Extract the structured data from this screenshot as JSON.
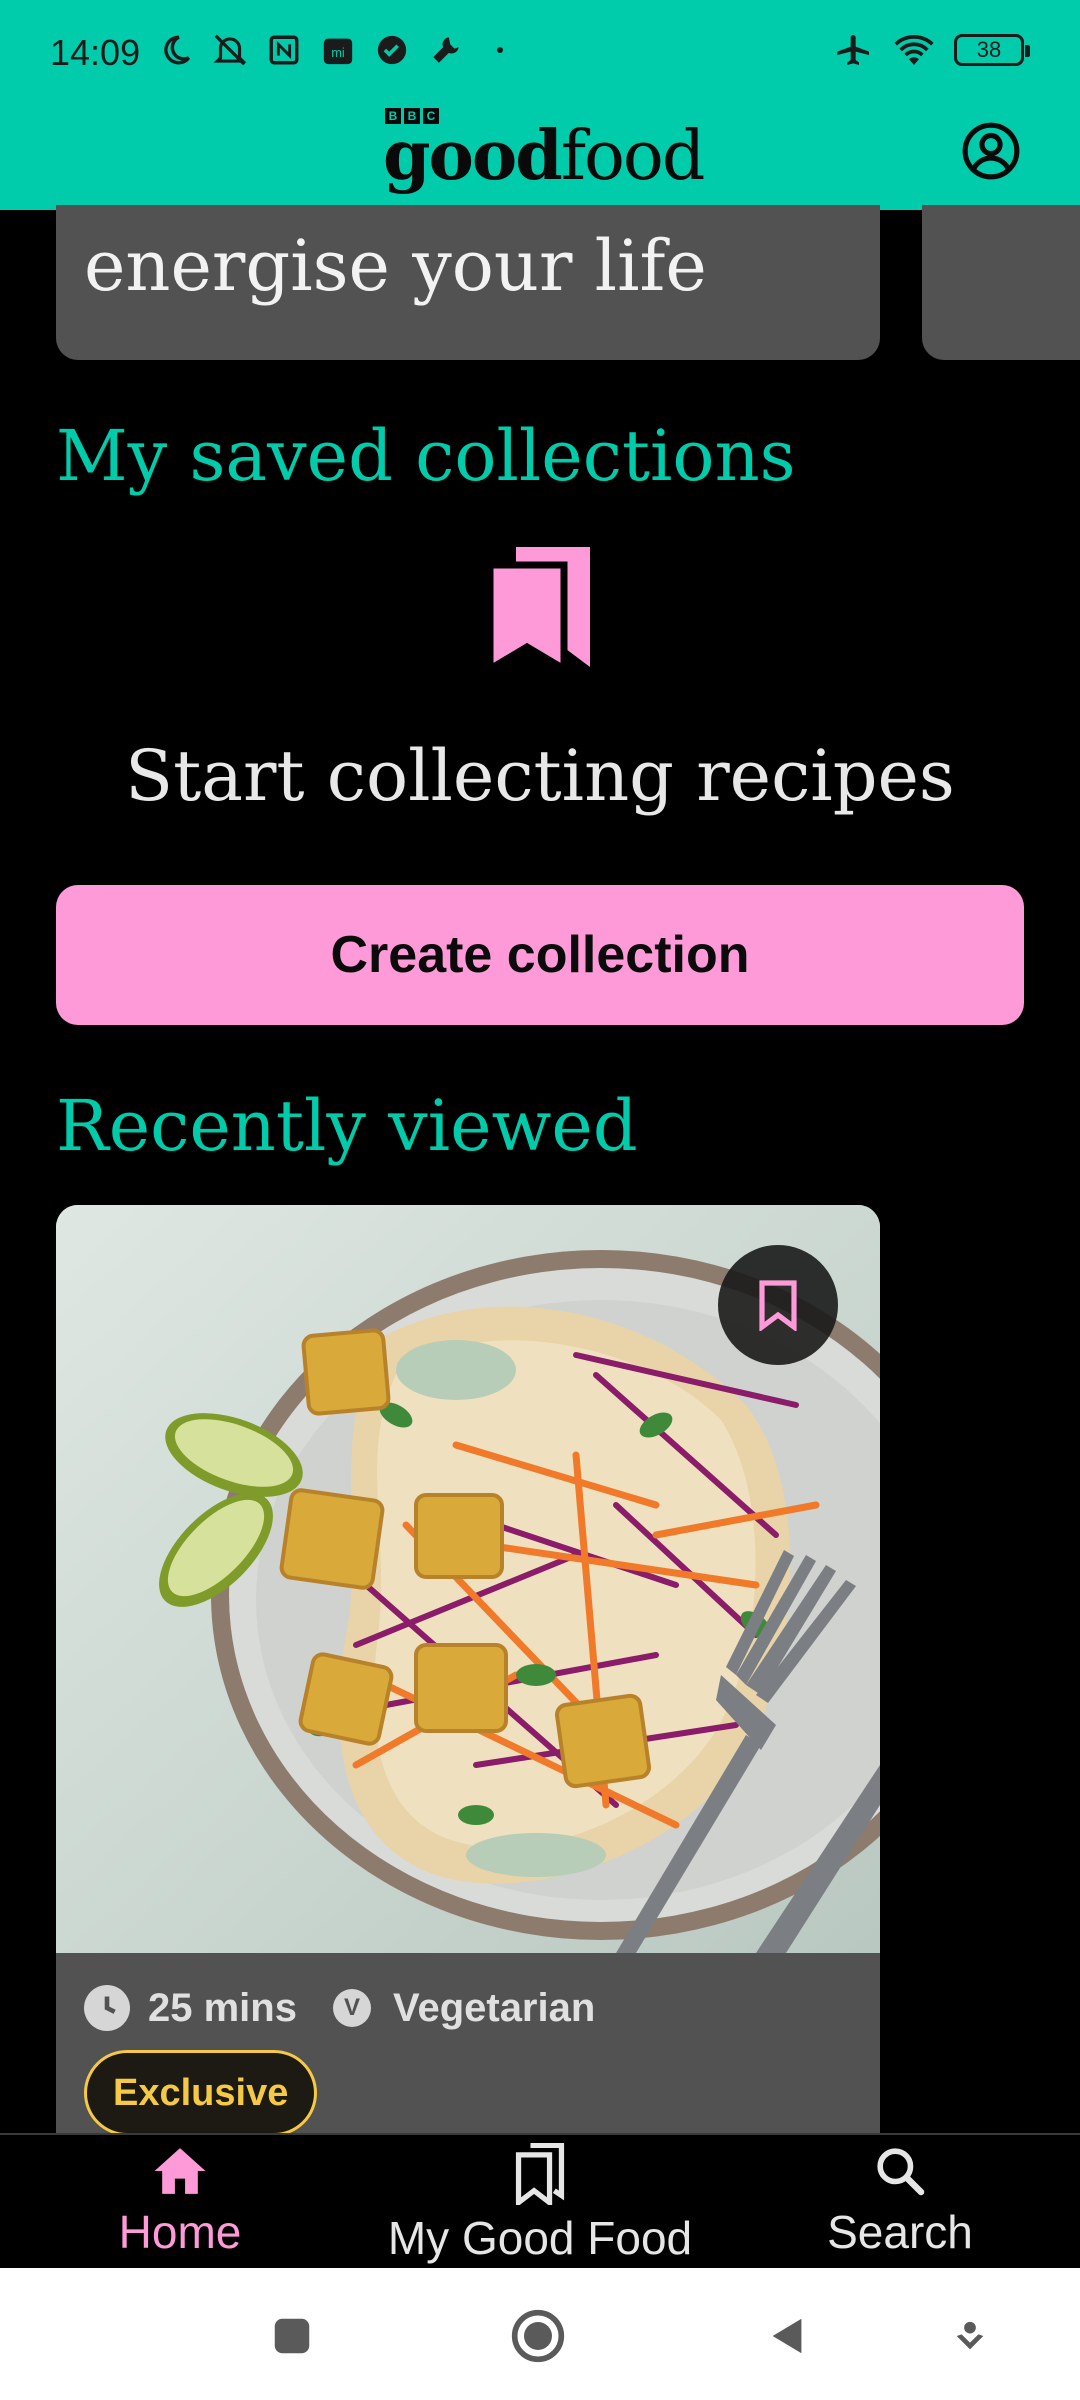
{
  "status_bar": {
    "time": "14:09",
    "battery": "38",
    "icons_left": [
      "moon-icon",
      "bell-off-icon",
      "nfc-icon",
      "mi-icon",
      "check-circle-icon",
      "wrench-icon",
      "dot-icon"
    ],
    "icons_right": [
      "airplane-icon",
      "wifi-icon",
      "battery-icon"
    ]
  },
  "header": {
    "brand_prefix": "BBC",
    "brand_good": "good",
    "brand_food": "food",
    "account_icon": "account-circle-icon",
    "background": "#00cbaa"
  },
  "promo": {
    "text": "energise your life"
  },
  "saved_collections": {
    "title": "My saved collections",
    "empty_icon": "bookmarks-icon",
    "empty_text": "Start collecting recipes",
    "create_button": "Create collection",
    "button_color": "#ff9ad9"
  },
  "recently_viewed": {
    "title": "Recently viewed",
    "card": {
      "time": "25 mins",
      "diet_badge": "V",
      "diet": "Vegetarian",
      "tag": "Exclusive",
      "save_icon": "bookmark-icon"
    }
  },
  "bottom_nav": {
    "items": [
      {
        "label": "Home",
        "icon": "home-icon",
        "active": true
      },
      {
        "label": "My Good Food",
        "icon": "bookmarks-icon",
        "active": false
      },
      {
        "label": "Search",
        "icon": "search-icon",
        "active": false
      }
    ]
  },
  "system_nav": [
    "recents-button",
    "home-button",
    "back-button",
    "assist-button"
  ]
}
